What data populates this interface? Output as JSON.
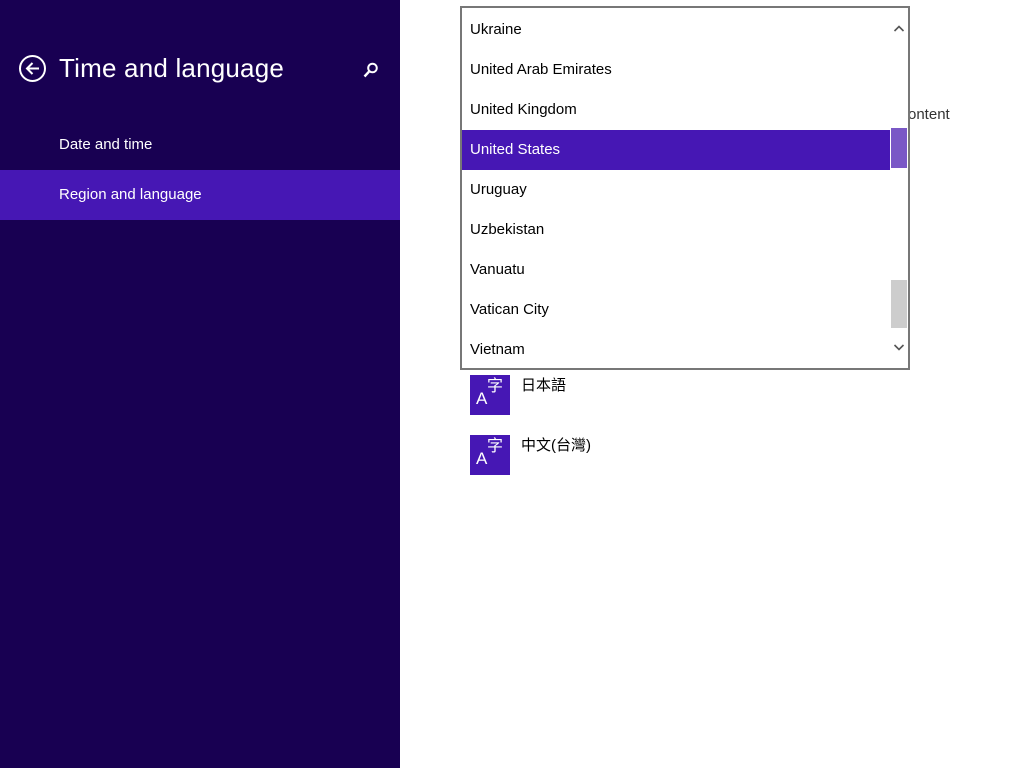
{
  "sidebar": {
    "title": "Time and language",
    "nav": [
      {
        "label": "Date and time"
      },
      {
        "label": "Region and language"
      }
    ]
  },
  "main": {
    "partial_text": "ontent",
    "languages": [
      {
        "name": "日本語",
        "tile_a": "A",
        "tile_k": "字"
      },
      {
        "name": "中文(台灣)",
        "tile_a": "A",
        "tile_k": "字"
      }
    ]
  },
  "dropdown": {
    "options": [
      "Ukraine",
      "United Arab Emirates",
      "United Kingdom",
      "United States",
      "Uruguay",
      "Uzbekistan",
      "Vanuatu",
      "Vatican City",
      "Vietnam"
    ],
    "selected": "United States"
  },
  "colors": {
    "sidebar_bg": "#180052",
    "accent": "#4617b4"
  }
}
